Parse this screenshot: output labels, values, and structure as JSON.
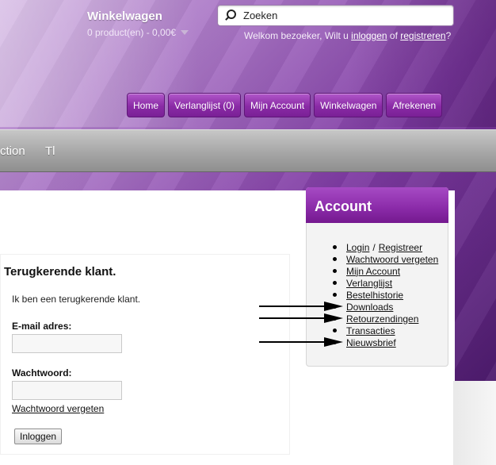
{
  "header": {
    "cart_title": "Winkelwagen",
    "cart_summary": "0 product(en) - 0,00€",
    "search_placeholder": "Zoeken",
    "welcome_prefix": "Welkom bezoeker, Wilt u",
    "welcome_login": "inloggen",
    "welcome_or": "of",
    "welcome_register": "registreren",
    "welcome_suffix": "?"
  },
  "top_nav": [
    "Home",
    "Verlanglijst (0)",
    "Mijn Account",
    "Winkelwagen",
    "Afrekenen"
  ],
  "menu_bar": {
    "item_1": "ction",
    "item_2": "Tl"
  },
  "login": {
    "heading": "Terugkerende klant.",
    "intro": "Ik ben een terugkerende klant.",
    "email_label": "E-mail adres:",
    "password_label": "Wachtwoord:",
    "forgot_link": "Wachtwoord vergeten",
    "login_button": "Inloggen"
  },
  "account": {
    "title": "Account",
    "login": "Login",
    "separator": "/",
    "register": "Registreer",
    "items": [
      "Wachtwoord vergeten",
      "Mijn Account",
      "Verlanglijst",
      "Bestelhistorie",
      "Downloads",
      "Retourzendingen",
      "Transacties",
      "Nieuwsbrief"
    ]
  },
  "annotations": {
    "arrow_targets": [
      "Downloads",
      "Retourzendingen",
      "Nieuwsbrief"
    ]
  },
  "colors": {
    "brand_purple": "#8a2ba6",
    "menu_gray": "#a9a9a9"
  }
}
